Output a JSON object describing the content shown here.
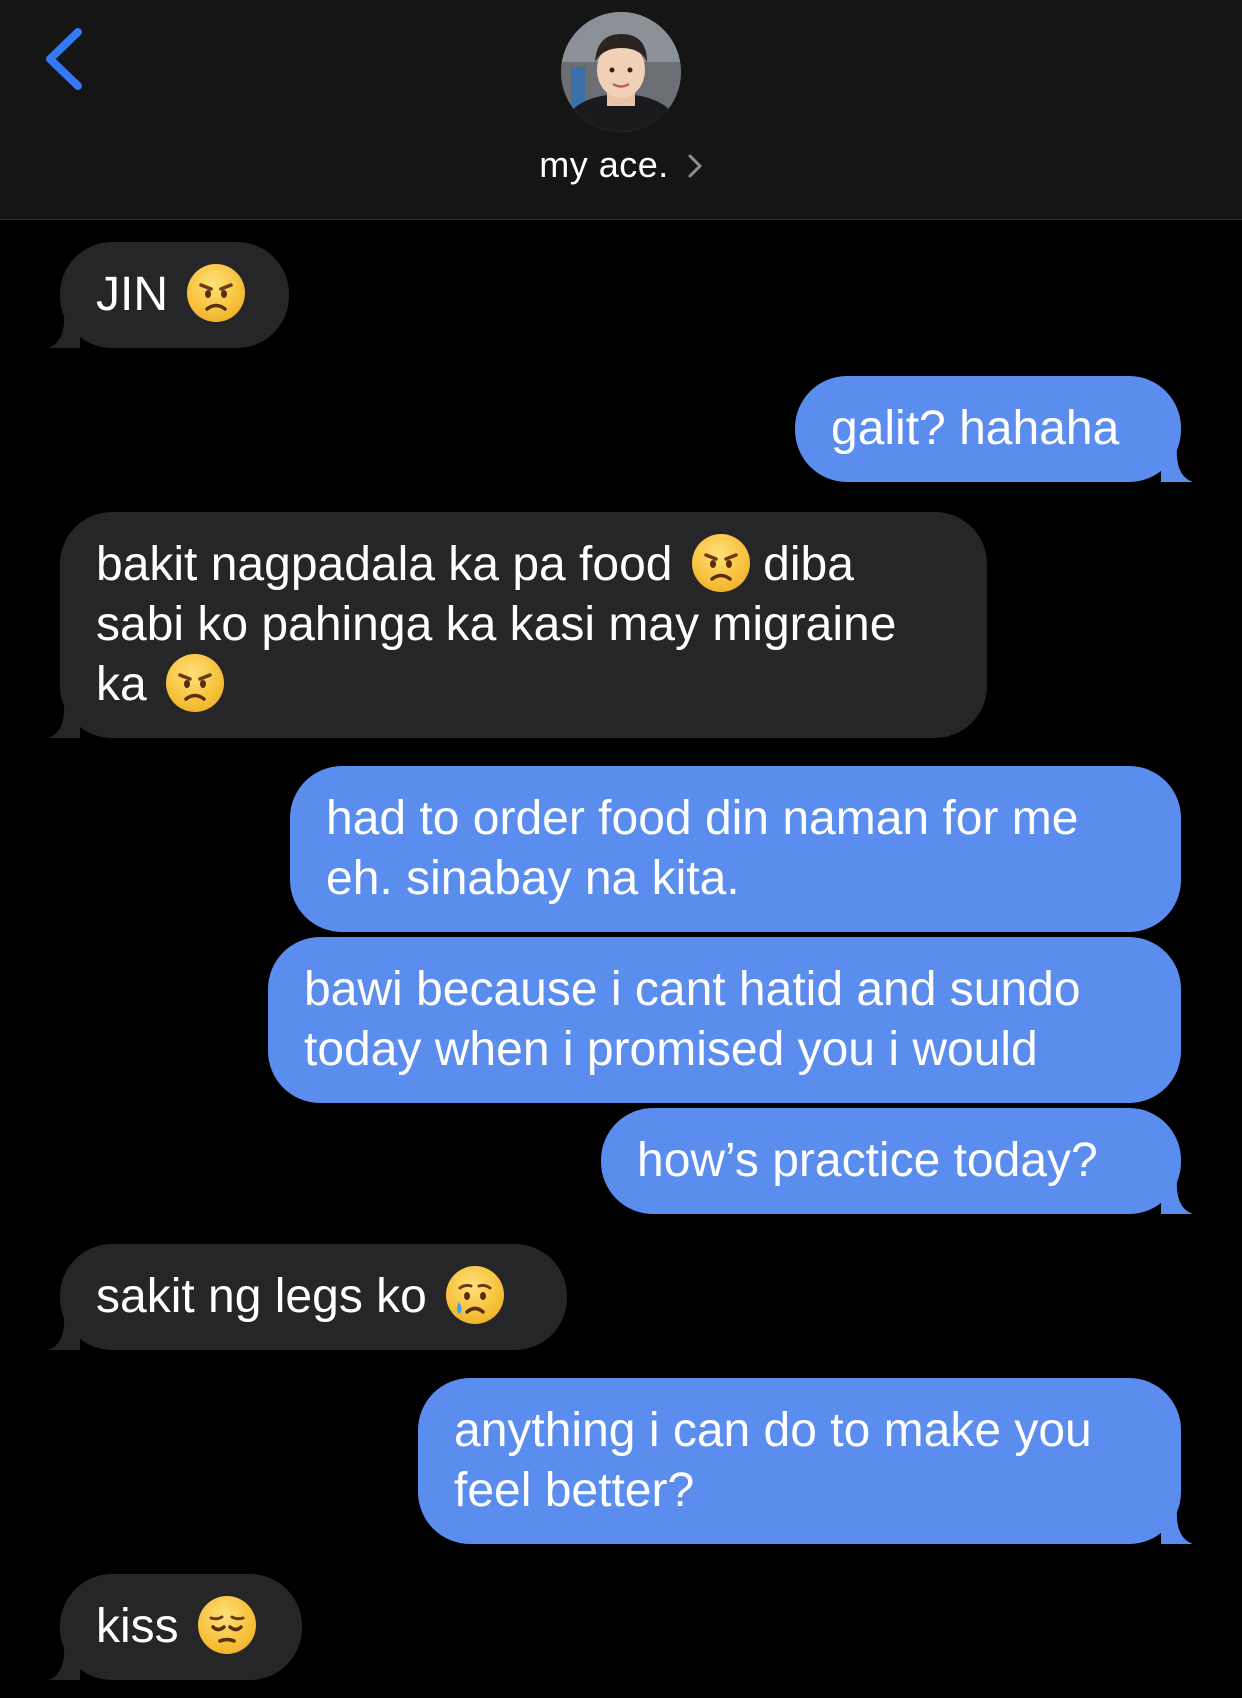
{
  "header": {
    "contact_name": "my ace.",
    "back_icon": "chevron-left-icon",
    "chevron_icon": "chevron-right-icon",
    "accent_color": "#3478f6"
  },
  "colors": {
    "incoming_bubble": "#262628",
    "outgoing_bubble": "#5b8def",
    "background": "#000000"
  },
  "messages": [
    {
      "direction": "in",
      "text": "JIN",
      "emoji": "angry-face-icon"
    },
    {
      "direction": "out",
      "text": "galit? hahaha"
    },
    {
      "direction": "in",
      "lines": [
        "bakit nagpadala ka pa food",
        "diba",
        "sabi ko pahinga ka kasi may migraine",
        "ka"
      ],
      "emoji": "angry-face-icon"
    },
    {
      "direction": "out",
      "lines": [
        "had to order food din naman for me",
        "eh. sinabay na kita."
      ]
    },
    {
      "direction": "out",
      "lines": [
        "bawi because i cant hatid and sundo",
        "today when i promised you i would"
      ]
    },
    {
      "direction": "out",
      "text": "how’s practice today?"
    },
    {
      "direction": "in",
      "text": "sakit ng legs ko",
      "emoji": "crying-face-icon"
    },
    {
      "direction": "out",
      "lines": [
        "anything i can do to make you",
        "feel better?"
      ]
    },
    {
      "direction": "in",
      "text": "kiss",
      "emoji": "pensive-face-icon"
    }
  ]
}
